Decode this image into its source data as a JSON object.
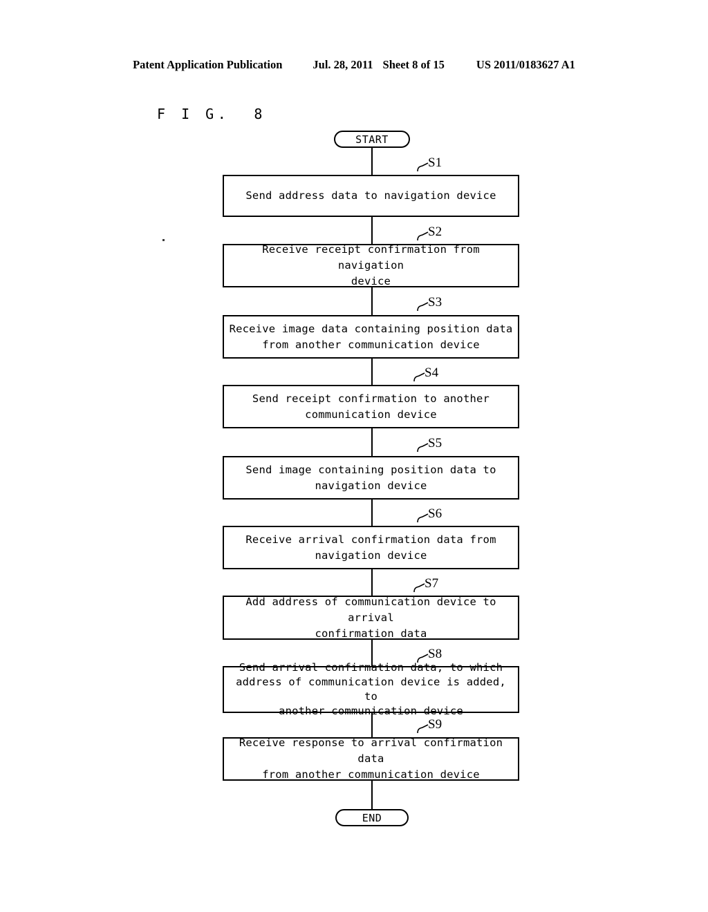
{
  "header": {
    "publication": "Patent Application Publication",
    "date": "Jul. 28, 2011",
    "sheet": "Sheet 8 of 15",
    "patent_number": "US 2011/0183627 A1"
  },
  "figure": {
    "label": "F I G.  8"
  },
  "flowchart": {
    "type": "flowchart",
    "orientation": "top-to-bottom",
    "start_label": "START",
    "end_label": "END",
    "steps": [
      {
        "tag": "S1",
        "text": "Send address data to navigation device"
      },
      {
        "tag": "S2",
        "text": "Receive receipt confirmation from navigation\ndevice"
      },
      {
        "tag": "S3",
        "text": "Receive image data containing position data\nfrom another communication device"
      },
      {
        "tag": "S4",
        "text": "Send receipt confirmation to another\ncommunication device"
      },
      {
        "tag": "S5",
        "text": "Send image containing position data to\nnavigation device"
      },
      {
        "tag": "S6",
        "text": "Receive arrival confirmation data from\nnavigation device"
      },
      {
        "tag": "S7",
        "text": "Add address of communication device to arrival\nconfirmation data"
      },
      {
        "tag": "S8",
        "text": "Send arrival confirmation data, to which\naddress of communication device is added, to\nanother communication device"
      },
      {
        "tag": "S9",
        "text": "Receive response to arrival confirmation data\nfrom another communication device"
      }
    ]
  },
  "colors": {
    "ink": "#000000",
    "paper": "#ffffff"
  }
}
